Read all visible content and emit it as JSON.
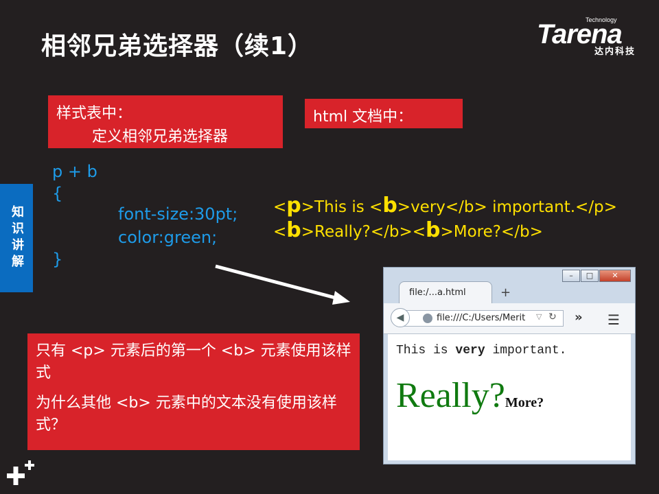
{
  "slide": {
    "title": "相邻兄弟选择器（续1）",
    "side_tab": "知识讲解"
  },
  "logo": {
    "tech": "Technology",
    "word": "Tarena",
    "cn": "达内科技"
  },
  "style_box": {
    "line1": "样式表中：",
    "line2": "定义相邻兄弟选择器"
  },
  "html_box": {
    "label": "html 文档中："
  },
  "code": {
    "selector": "p + b",
    "open_brace": "{",
    "decl1": "font-size:30pt;",
    "decl2": "color:green;",
    "close_brace": "}"
  },
  "html_source": {
    "line1": {
      "lt1": "<",
      "tag1": "p",
      "seg1": ">This is <",
      "tag2": "b",
      "seg2": ">very</b> important.</p>"
    },
    "line2": {
      "lt1": "<",
      "tag1": "b",
      "seg1": ">Really?</b><",
      "tag2": "b",
      "seg2": ">More?</b>"
    }
  },
  "question": {
    "q1": "只有 <p> 元素后的第一个 <b> 元素使用该样式",
    "q2": "为什么其他 <b> 元素中的文本没有使用该样式？"
  },
  "browser": {
    "tab_title": "file:/...a.html",
    "new_tab": "+",
    "url": "file:///C:/Users/Merit",
    "content": {
      "pre": "This is ",
      "bold": "very",
      "post": " important.",
      "really": "Really?",
      "more": "More?"
    }
  },
  "colors": {
    "background": "#231f20",
    "red": "#d8232a",
    "blue_tab": "#0b6cc0",
    "code_blue": "#1e9be8",
    "yellow": "#ffe000",
    "green_text": "#107a10"
  },
  "icons": [
    "back-arrow-icon",
    "globe-icon",
    "dropdown-icon",
    "reload-icon",
    "overflow-icon",
    "menu-icon",
    "minimize-icon",
    "maximize-icon",
    "close-icon",
    "arrow-icon",
    "plus-icon"
  ]
}
